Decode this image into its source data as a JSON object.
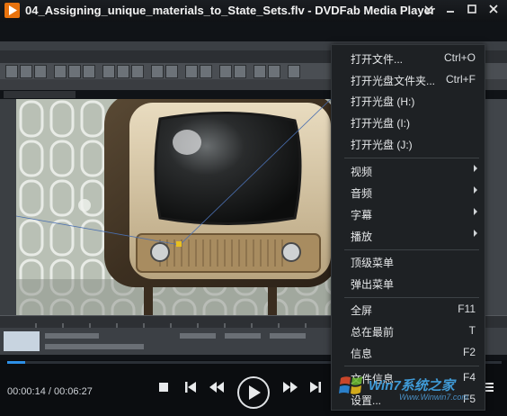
{
  "titlebar": {
    "title": "04_Assigning_unique_materials_to_State_Sets.flv - DVDFab Media Player",
    "icons": [
      "play-logo-icon",
      "expand-icon",
      "minimize-icon",
      "restore-icon",
      "close-icon"
    ]
  },
  "player": {
    "current_time": "00:00:14",
    "total_time": "00:06:27",
    "time_display": "00:00:14 / 00:06:27",
    "progress_fraction": 0.036,
    "accent_color": "#2d8fe6"
  },
  "controls": [
    "stop-icon",
    "previous-icon",
    "rewind-icon",
    "play-icon",
    "fast-forward-icon",
    "next-icon",
    "menu-icon"
  ],
  "menu": {
    "items": [
      {
        "label": "打开文件...",
        "shortcut": "Ctrl+O"
      },
      {
        "label": "打开光盘文件夹...",
        "shortcut": "Ctrl+F"
      },
      {
        "label": "打开光盘 (H:)",
        "shortcut": ""
      },
      {
        "label": "打开光盘 (I:)",
        "shortcut": ""
      },
      {
        "label": "打开光盘 (J:)",
        "shortcut": ""
      },
      {
        "label": "视频",
        "shortcut": "",
        "submenu": true
      },
      {
        "label": "音频",
        "shortcut": "",
        "submenu": true
      },
      {
        "label": "字幕",
        "shortcut": "",
        "submenu": true
      },
      {
        "label": "播放",
        "shortcut": "",
        "submenu": true
      },
      {
        "label": "顶级菜单",
        "shortcut": ""
      },
      {
        "label": "弹出菜单",
        "shortcut": ""
      },
      {
        "label": "全屏",
        "shortcut": "F11"
      },
      {
        "label": "总在最前",
        "shortcut": "T"
      },
      {
        "label": "信息",
        "shortcut": "F2"
      },
      {
        "label": "文件信息",
        "shortcut": "F4"
      },
      {
        "label": "设置...",
        "shortcut": "F5"
      }
    ]
  },
  "watermark": {
    "brand": "Win7系统之家",
    "url": "Www.Winwin7.com"
  }
}
